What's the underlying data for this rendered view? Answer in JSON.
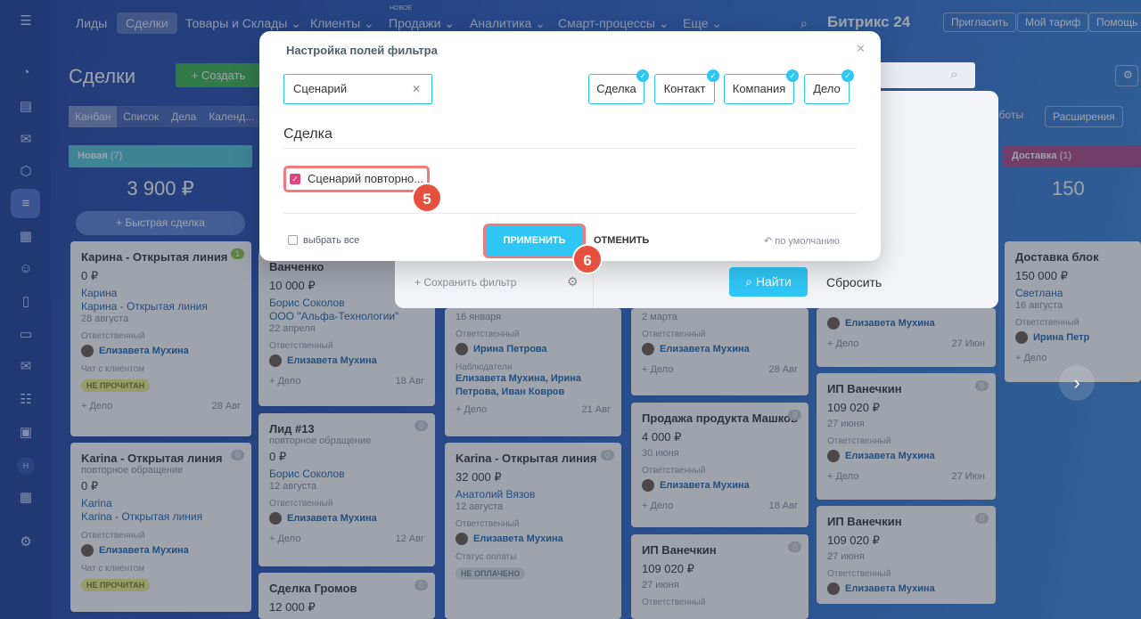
{
  "topnav": {
    "items": [
      {
        "label": "Лиды"
      },
      {
        "label": "Сделки"
      },
      {
        "label": "Товары и Склады ⌄"
      },
      {
        "label": "Клиенты ⌄"
      },
      {
        "label": "Продажи ⌄"
      },
      {
        "label": "Аналитика ⌄"
      },
      {
        "label": "Смарт-процессы ⌄"
      },
      {
        "label": "Еще ⌄"
      }
    ],
    "new_badge": "НОВОЕ",
    "brand": "Битрикс 24",
    "invite": "Пригласить",
    "tariff": "Мой тариф",
    "help": "Помощь"
  },
  "page": {
    "title": "Сделки",
    "create": "+ Создать",
    "views": [
      "Канбан",
      "Список",
      "Дела",
      "Календ..."
    ],
    "extensions": "Расширения",
    "robots": "оботы"
  },
  "columns": [
    {
      "name": "Новая",
      "count": "(7)",
      "sum": "3 900 ₽",
      "color": "#52c7d8"
    },
    {
      "name": "Доставка",
      "count": "(1)",
      "sum": "150",
      "color": "#ad4786"
    }
  ],
  "quick_deal": "+ Быстрая сделка",
  "cards": {
    "c1": {
      "title": "Карина - Открытая линия",
      "count": "1",
      "amount": "0 ₽",
      "link1": "Карина",
      "link2": "Карина - Открытая линия",
      "date": "28 августа",
      "resp_label": "Ответственный",
      "resp": "Елизавета Мухина",
      "chat_label": "Чат с клиентом",
      "badge": "НЕ ПРОЧИТАН",
      "deal": "+ Дело",
      "due": "28 Авг"
    },
    "c2": {
      "title": "Karina - Открытая линия",
      "count": "0",
      "sub": "повторное обращение",
      "amount": "0 ₽",
      "link1": "Karina",
      "link2": "Karina - Открытая линия",
      "resp_label": "Ответственный",
      "resp": "Елизавета Мухина",
      "chat_label": "Чат с клиентом",
      "badge": "НЕ ПРОЧИТАН"
    },
    "c3": {
      "title": "Ванченко",
      "amount": "10 000 ₽",
      "link1": "Борис Соколов",
      "link2": "ООО \"Альфа-Технологии\"",
      "date": "22 апреля",
      "resp_label": "Ответственный",
      "resp": "Елизавета Мухина",
      "deal": "+ Дело",
      "due": "18 Авг"
    },
    "c4": {
      "title": "Лид #13",
      "count": "0",
      "sub": "повторное обращение",
      "amount": "0 ₽",
      "link1": "Борис Соколов",
      "date": "12 августа",
      "resp_label": "Ответственный",
      "resp": "Елизавета Мухина",
      "deal": "+ Дело",
      "due": "12 Авг"
    },
    "c5": {
      "title": "Сделка Громов",
      "count": "0",
      "amount": "12 000 ₽"
    },
    "c6": {
      "date": "16 января",
      "resp_label": "Ответственный",
      "resp": "Ирина Петрова",
      "obs_label": "Наблюдатели",
      "obs": "Елизавета Мухина, Ирина Петрова, Иван Ковров",
      "deal": "+ Дело",
      "due": "21 Авг"
    },
    "c7": {
      "title": "Karina - Открытая линия",
      "count": "0",
      "amount": "32 000 ₽",
      "link1": "Анатолий Вязов",
      "date": "12 августа",
      "resp_label": "Ответственный",
      "resp": "Елизавета Мухина",
      "pay_label": "Статус оплаты",
      "pay": "НЕ ОПЛАЧЕНО"
    },
    "c8": {
      "date": "2 марта",
      "resp_label": "Ответственный",
      "resp": "Елизавета Мухина",
      "deal": "+ Дело",
      "due": "28 Авг"
    },
    "c9": {
      "title": "Продажа продукта Машков",
      "count": "0",
      "amount": "4 000 ₽",
      "date": "30 июня",
      "resp_label": "Ответственный",
      "resp": "Елизавета Мухина",
      "deal": "+ Дело",
      "due": "18 Авг"
    },
    "c10": {
      "title": "ИП Ванечкин",
      "count": "0",
      "amount": "109 020 ₽",
      "date": "27 июня",
      "resp_label": "Ответственный"
    },
    "c11": {
      "resp": "Елизавета Мухина",
      "deal": "+ Дело",
      "due": "27 Июн"
    },
    "c12": {
      "title": "ИП Ванечкин",
      "count": "0",
      "amount": "109 020 ₽",
      "date": "27 июня",
      "resp_label": "Ответственный",
      "resp": "Елизавета Мухина",
      "deal": "+ Дело",
      "due": "27 Июн"
    },
    "c13": {
      "title": "ИП Ванечкин",
      "count": "0",
      "amount": "109 020 ₽",
      "date": "27 июня",
      "resp_label": "Ответственный",
      "resp": "Елизавета Мухина"
    },
    "c14": {
      "title": "Доставка блок",
      "amount": "150 000 ₽",
      "link1": "Светлана",
      "date": "16 августа",
      "resp_label": "Ответственный",
      "resp": "Ирина Петр",
      "deal": "+ Дело"
    }
  },
  "filter": {
    "save": "+ Сохранить фильтр",
    "find": "Найти",
    "reset": "Сбросить"
  },
  "modal": {
    "title": "Настройка полей фильтра",
    "search_value": "Сценарий",
    "categories": [
      "Сделка",
      "Контакт",
      "Компания",
      "Дело"
    ],
    "section": "Сделка",
    "field": "Сценарий повторно...",
    "select_all": "выбрать все",
    "apply": "ПРИМЕНИТЬ",
    "cancel": "ОТМЕНИТЬ",
    "default": "по умолчанию",
    "step5": "5",
    "step6": "6"
  },
  "icons": [
    "menu-icon",
    "search-icon",
    "gear-icon",
    "close-icon",
    "check-icon",
    "undo-icon",
    "chevron-right-icon"
  ]
}
